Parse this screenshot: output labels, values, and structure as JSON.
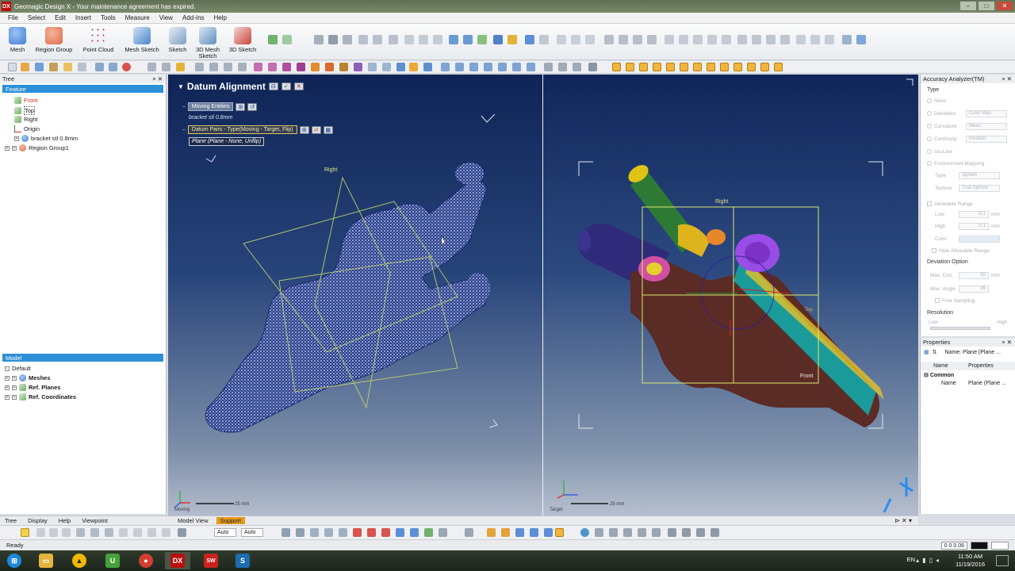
{
  "window": {
    "title": "Geomagic Design X - Your maintenance agreement has expired.",
    "app_icon": "DX"
  },
  "menu": [
    "File",
    "Select",
    "Edit",
    "Insert",
    "Tools",
    "Measure",
    "View",
    "Add-Ins",
    "Help"
  ],
  "ribbon": {
    "tools": [
      {
        "label": "Mesh",
        "icon": "mesh-icon",
        "color": "#3f7fd6"
      },
      {
        "label": "Region Group",
        "icon": "region-group-icon",
        "color": "#e06d4a"
      },
      {
        "label": "Point Cloud",
        "icon": "point-cloud-icon",
        "color": "#b23a8d"
      },
      {
        "label": "Mesh Sketch",
        "icon": "mesh-sketch-icon",
        "color": "#4a86cc"
      },
      {
        "label": "Sketch",
        "icon": "sketch-icon",
        "color": "#7aa0c4"
      },
      {
        "label": "3D Mesh Sketch",
        "icon": "3d-mesh-sketch-icon",
        "color": "#5f8fbe"
      },
      {
        "label": "3D Sketch",
        "icon": "3d-sketch-icon",
        "color": "#c9423b"
      }
    ]
  },
  "tree_panel": {
    "title": "Tree",
    "section": "Feature",
    "items": [
      {
        "label": "Front",
        "icon": "plane-icon",
        "color": "#cc2a1f"
      },
      {
        "label": "Top",
        "icon": "plane-icon",
        "color": "#1a1a1a"
      },
      {
        "label": "Right",
        "icon": "plane-icon",
        "color": "#1a1a1a"
      },
      {
        "label": "Origin",
        "icon": "origin-icon",
        "color": "#1a1a1a"
      },
      {
        "label": "bracket stl 0.8mm",
        "icon": "mesh-icon",
        "color": "#1a1a1a"
      },
      {
        "label": "Region Group1",
        "icon": "region-group-icon",
        "color": "#1a1a1a"
      }
    ]
  },
  "model_panel": {
    "title": "Model",
    "items": [
      {
        "label": "Default"
      },
      {
        "label": "Meshes"
      },
      {
        "label": "Ref. Planes"
      },
      {
        "label": "Ref. Coordinates"
      }
    ]
  },
  "left_tabs": [
    "Tree",
    "Display",
    "Help",
    "Viewpoint"
  ],
  "datum_alignment": {
    "title": "Datum Alignment",
    "moving_entities_label": "Moving Entities",
    "moving_entity_value": "bracket stl 0.8mm",
    "pairs_label": "Datum Pairs - Type(Moving - Target, Flip)",
    "pair_value": "Plane (Plane - None, Unflip)"
  },
  "viewport_left": {
    "plane_label": "Right",
    "scale_label": "25 mm",
    "corner_label": "Moving"
  },
  "viewport_right": {
    "plane_label_right": "Right",
    "plane_label_front": "Front",
    "plane_label_top": "Top",
    "scale_label": "25 mm",
    "corner_label": "Target"
  },
  "view_tabs": [
    "Model View",
    "Support"
  ],
  "bottom_toolbar": {
    "select_auto_1": "Auto",
    "select_auto_2": "Auto"
  },
  "status": {
    "text": "Ready",
    "time_value": "0 0 0.06"
  },
  "accuracy_panel": {
    "title": "Accuracy Analyzer(TM)",
    "type_label": "Type",
    "options": [
      "None",
      "Deviation",
      "Curvature",
      "Continuity",
      "Iso-Line",
      "Environment Mapping"
    ],
    "deviation_value": "Color Map",
    "curvature_value": "Mean",
    "continuity_value": "Position",
    "env_type_label": "Type",
    "env_type_value": "Sphere",
    "texture_label": "Texture",
    "texture_value": "True Sphere",
    "allowable_range_label": "Allowable Range",
    "low_label": "Low",
    "low_value": "-0.1",
    "high_label": "High",
    "high_value": "0.1",
    "unit": "mm",
    "color_label": "Color",
    "hide_label": "Hide Allowable Range",
    "deviation_option_label": "Deviation Option",
    "max_dist_label": "Max. Dist.",
    "max_dist_value": "50",
    "max_angle_label": "Max. Angle",
    "max_angle_value": "45",
    "fine_sampling_label": "Fine Sampling",
    "resolution_label": "Resolution",
    "res_low": "Low",
    "res_high": "High"
  },
  "properties_panel": {
    "title": "Properties",
    "name_header": "Name: Plane (Plane ...",
    "col_name": "Name",
    "col_properties": "Properties",
    "group": "Common",
    "row_name": "Name",
    "row_value": "Plane (Plane ..."
  },
  "taskbar": {
    "apps": [
      {
        "icon": "windows-start-icon",
        "color": "#1f88d8",
        "glyph": "⊞"
      },
      {
        "icon": "file-explorer-icon",
        "color": "#e4b43c",
        "glyph": "▭"
      },
      {
        "icon": "norton-icon",
        "color": "#f0b800",
        "glyph": "▲"
      },
      {
        "icon": "upwork-icon",
        "color": "#43a23b",
        "glyph": "U"
      },
      {
        "icon": "chrome-icon",
        "color": "#d23f31",
        "glyph": "●"
      },
      {
        "icon": "design-x-icon",
        "color": "#b80e0e",
        "glyph": "DX"
      },
      {
        "icon": "solidworks-icon",
        "color": "#c8231e",
        "glyph": "SW"
      },
      {
        "icon": "geomagic-icon",
        "color": "#1e6bb0",
        "glyph": "S"
      }
    ],
    "lang": "EN",
    "time": "11:50 AM",
    "date": "11/19/2016"
  }
}
